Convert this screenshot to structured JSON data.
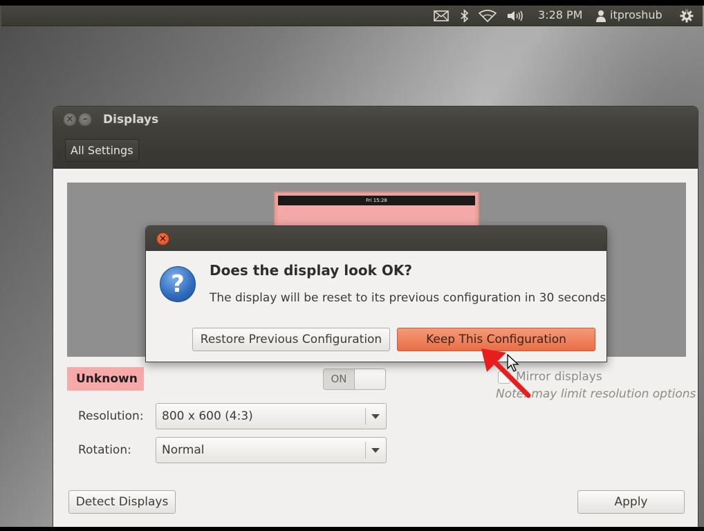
{
  "panel": {
    "clock": "3:28 PM",
    "user": "itproshub",
    "icons": [
      "mail-icon",
      "bluetooth-icon",
      "wifi-icon",
      "volume-icon",
      "user-icon",
      "gear-icon"
    ]
  },
  "window": {
    "title": "Displays",
    "toolbar": {
      "all_settings": "All Settings"
    },
    "preview": {
      "panel_clock": "Fri 15:28"
    },
    "monitor_label": "Unknown",
    "toggle": {
      "label": "ON"
    },
    "mirror": {
      "label": "Mirror displays",
      "note": "Note: may limit resolution options"
    },
    "resolution": {
      "label": "Resolution:",
      "value": "800 x 600 (4:3)"
    },
    "rotation": {
      "label": "Rotation:",
      "value": "Normal"
    },
    "detect_button": "Detect Displays",
    "apply_button": "Apply"
  },
  "dialog": {
    "heading": "Does the display look OK?",
    "message": "The display will be reset to its previous configuration in 30 seconds",
    "restore_button": "Restore Previous Configuration",
    "keep_button": "Keep This Configuration"
  },
  "colors": {
    "accent": "#e86f47",
    "monitor_color": "#f7a9a9",
    "annotation_arrow": "#e81d1d"
  }
}
